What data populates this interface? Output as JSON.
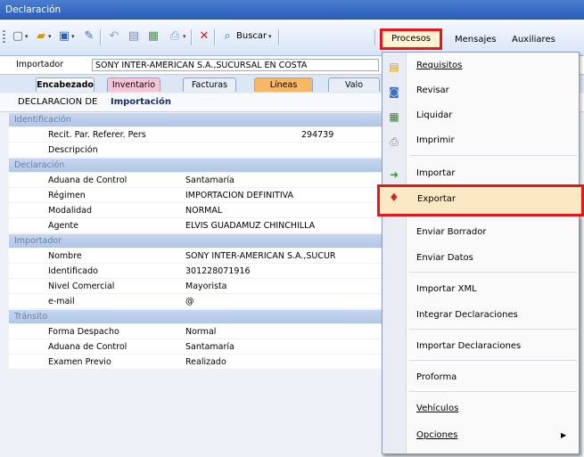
{
  "window": {
    "title": "Declaración"
  },
  "toolbar": {
    "buscar_label": "Buscar",
    "menus": {
      "procesos": "Procesos",
      "mensajes": "Mensajes",
      "auxiliares": "Auxiliares"
    }
  },
  "importador": {
    "label": "Importador",
    "value": "SONY INTER-AMERICAN S.A.,SUCURSAL EN COSTA"
  },
  "tabs": [
    "Encabezado",
    "Inventario",
    "Facturas",
    "Líneas",
    "Valo"
  ],
  "panel": {
    "prefix": "DECLARACION DE",
    "type": "Importación"
  },
  "sections": [
    {
      "title": "Identificación",
      "rows": [
        {
          "k": "Recit. Par. Referer. Pers",
          "v": "294739"
        },
        {
          "k": "Descripción",
          "v": ""
        }
      ]
    },
    {
      "title": "Declaración",
      "rows": [
        {
          "k": "Aduana de Control",
          "v": "Santamaría"
        },
        {
          "k": "Régimen",
          "v": "IMPORTACION DEFINITIVA"
        },
        {
          "k": "Modalidad",
          "v": "NORMAL"
        },
        {
          "k": "Agente",
          "v": "ELVIS GUADAMUZ CHINCHILLA"
        }
      ]
    },
    {
      "title": "Importador",
      "rows": [
        {
          "k": "Nombre",
          "v": "SONY INTER-AMERICAN S.A.,SUCUR"
        },
        {
          "k": "Identificado",
          "v": "301228071916"
        },
        {
          "k": "Nivel Comercial",
          "v": "Mayorista"
        },
        {
          "k": "e-mail",
          "v": "@"
        }
      ]
    },
    {
      "title": "Tránsito",
      "rows": [
        {
          "k": "Forma Despacho",
          "v": "Normal"
        },
        {
          "k": "Aduana de Control",
          "v": "Santamaría"
        },
        {
          "k": "Examen Previo",
          "v": "Realizado"
        }
      ]
    }
  ],
  "dropdown": {
    "items": [
      "Requisitos",
      "Revisar",
      "Liquidar",
      "Imprimir",
      "Importar",
      "Exportar",
      "Enviar Borrador",
      "Enviar Datos",
      "Importar XML",
      "Integrar Declaraciones",
      "Importar Declaraciones",
      "Proforma",
      "Vehículos",
      "Opciones"
    ]
  },
  "colors": {
    "highlight": "#e8151b",
    "accent": "#2a5cb8"
  }
}
